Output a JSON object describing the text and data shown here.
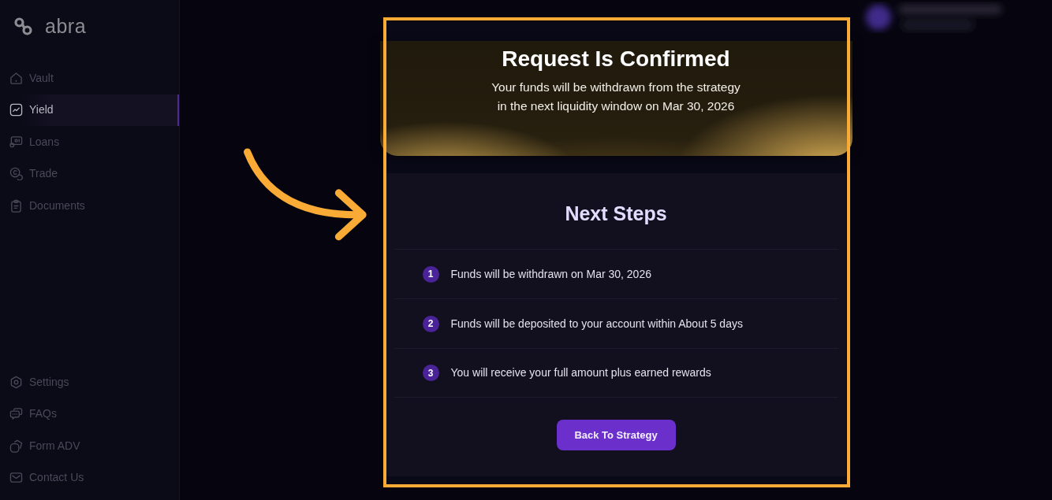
{
  "sidebar": {
    "logo": "abra",
    "nav_items": [
      {
        "label": "Vault",
        "selected": false
      },
      {
        "label": "Yield",
        "selected": true
      },
      {
        "label": "Loans",
        "selected": false
      },
      {
        "label": "Trade",
        "selected": false
      },
      {
        "label": "Documents",
        "selected": false
      }
    ],
    "bottom_items": [
      {
        "label": "Settings",
        "selected": false
      },
      {
        "label": "FAQs",
        "selected": false
      },
      {
        "label": "Form ADV",
        "selected": false
      },
      {
        "label": "Contact Us",
        "selected": false
      }
    ]
  },
  "confirmation": {
    "title": "Request Is Confirmed",
    "message": "Your funds will be withdrawn from the strategy\nin the next liquidity window on Mar 30, 2026"
  },
  "next_steps": {
    "title": "Next Steps",
    "steps": [
      {
        "number": "1",
        "text": "Funds will be withdrawn on Mar 30, 2026"
      },
      {
        "number": "2",
        "text": "Funds will be deposited to your account within About 5 days"
      },
      {
        "number": "3",
        "text": "You will receive your full amount plus earned rewards"
      }
    ],
    "button": "Back To Strategy"
  }
}
